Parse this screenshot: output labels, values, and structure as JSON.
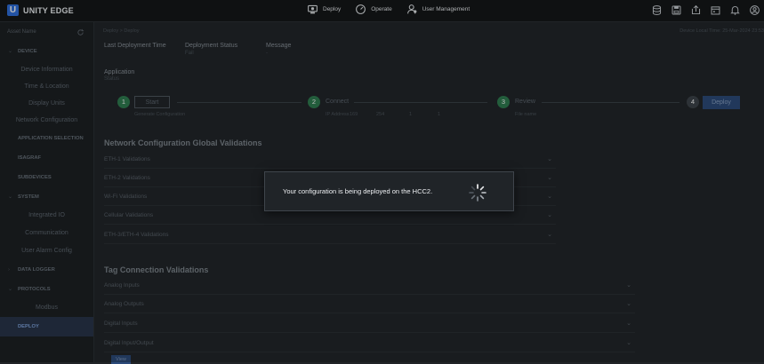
{
  "app": {
    "brand_letter": "U",
    "brand_name": "UNITY EDGE"
  },
  "topnav": [
    {
      "label": "Deploy",
      "icon": "deploy-icon"
    },
    {
      "label": "Operate",
      "icon": "gauge-icon"
    },
    {
      "label": "User Management",
      "icon": "user-management-icon"
    }
  ],
  "top_icons": [
    "database-icon",
    "save-icon",
    "upload-icon",
    "calendar-icon",
    "bell-icon",
    "account-icon"
  ],
  "sidebar": {
    "asset_label": "Asset Name",
    "device": {
      "label": "DEVICE",
      "items": [
        "Device Information",
        "Time & Location",
        "Display Units",
        "Network Configuration"
      ]
    },
    "application_selection": "APPLICATION SELECTION",
    "isagraf": "ISAGRAF",
    "subdevices": "SUBDEVICES",
    "system": {
      "label": "SYSTEM",
      "items": [
        "Integrated IO",
        "Communication",
        "User Alarm Config"
      ]
    },
    "data_logger": "DATA LOGGER",
    "protocols": {
      "label": "PROTOCOLS",
      "items": [
        "Modbus"
      ]
    },
    "deploy": "DEPLOY"
  },
  "main": {
    "breadcrumb": "Deploy > Deploy",
    "local_time": "Device Local Time: 25-Mar-2024 23:53",
    "info": {
      "last_time_label": "Last Deployment Time",
      "status_label": "Deployment Status",
      "status_value": "Fail",
      "message_label": "Message",
      "message_value": "-"
    },
    "application": {
      "label": "Application",
      "value": "Status"
    },
    "steps": {
      "s1_num": "1",
      "s1_label": "Start",
      "s1_sub": "Generate Configuration",
      "s2_num": "2",
      "s2_label": "Connect",
      "s2_sub_label": "IP Address",
      "ip": [
        "169",
        "254",
        "1",
        "1"
      ],
      "s3_num": "3",
      "s3_label": "Review",
      "s3_sub": "File name",
      "s4_num": "4",
      "s4_label": "Deploy"
    },
    "network_section": {
      "title": "Network Configuration Global Validations",
      "rows": [
        "ETH-1 Validations",
        "ETH-2 Validations",
        "Wi-Fi Validations",
        "Cellular Validations",
        "ETH-3/ETH-4 Validations"
      ]
    },
    "tag_section": {
      "title": "Tag Connection Validations",
      "rows": [
        "Analog Inputs",
        "Analog Outputs",
        "Digital Inputs",
        "Digital Input/Output"
      ]
    },
    "view_button": "View"
  },
  "dialog": {
    "message": "Your configuration is being deployed on the HCC2."
  },
  "colors": {
    "accent": "#2f6fe0",
    "step_green": "#2e8b57",
    "dialog_bg": "#202428"
  }
}
